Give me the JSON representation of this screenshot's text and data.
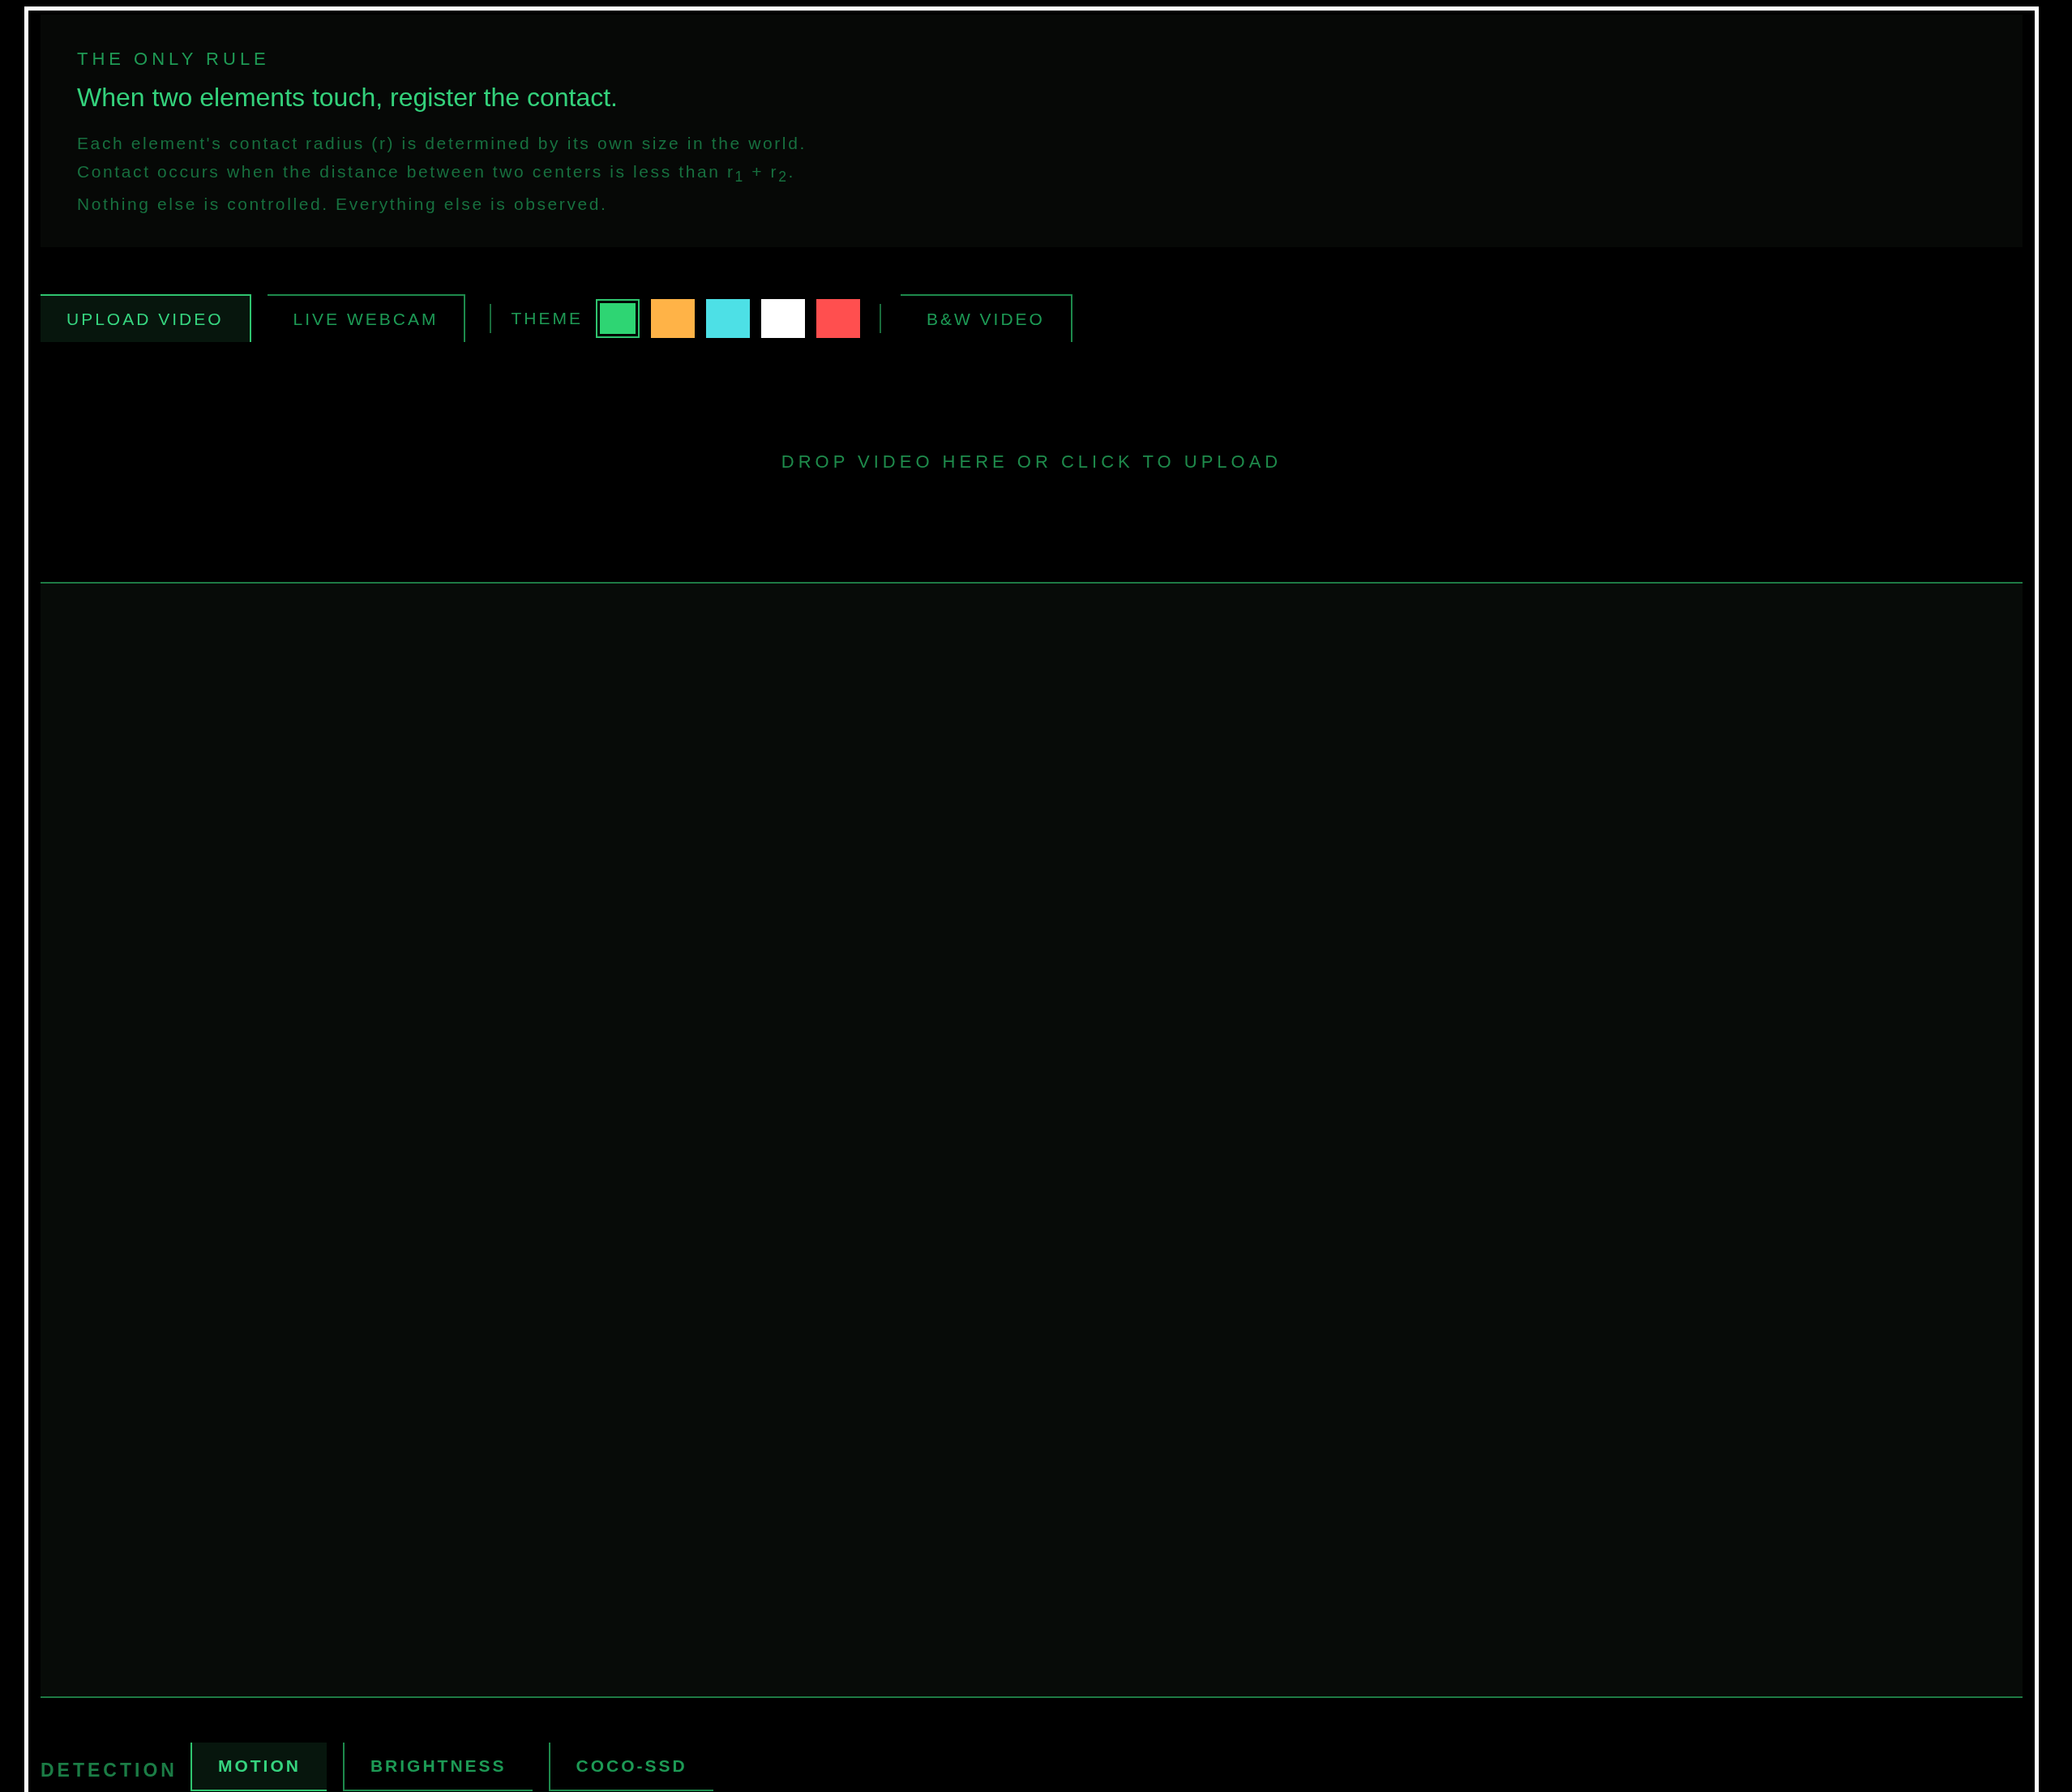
{
  "rule": {
    "label": "THE ONLY RULE",
    "headline": "When two elements touch, register the contact.",
    "lines": [
      "Each element's contact radius (r) is determined by its own size in the world.",
      "Contact occurs when the distance between two centers is less than r$_{1}$ + r$_{2}$.",
      "Nothing else is controlled. Everything else is observed."
    ]
  },
  "source_tabs": [
    {
      "label": "UPLOAD VIDEO",
      "selected": true
    },
    {
      "label": "LIVE WEBCAM",
      "selected": false
    }
  ],
  "theme": {
    "label": "THEME",
    "swatches": [
      {
        "color": "#2ed573",
        "selected": true
      },
      {
        "color": "#ffb347",
        "selected": false
      },
      {
        "color": "#4de0e6",
        "selected": false
      },
      {
        "color": "#ffffff",
        "selected": false
      },
      {
        "color": "#ff4f4f",
        "selected": false
      }
    ]
  },
  "bw_video": {
    "label": "B&W VIDEO",
    "on": false
  },
  "drop_zone": {
    "text": "DROP VIDEO HERE OR CLICK TO UPLOAD"
  },
  "detection": {
    "label": "DETECTION",
    "tabs": [
      {
        "label": "MOTION",
        "selected": true
      },
      {
        "label": "BRIGHTNESS",
        "selected": false
      },
      {
        "label": "COCO-SSD",
        "selected": false
      }
    ]
  }
}
